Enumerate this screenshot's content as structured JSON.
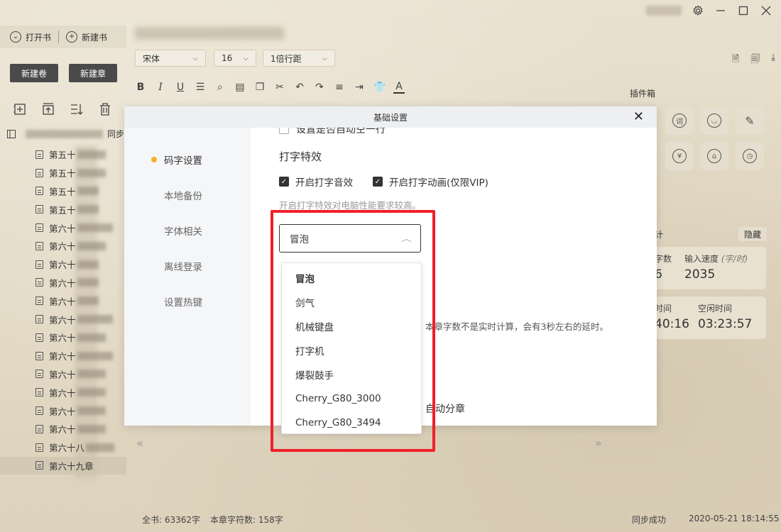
{
  "window": {
    "controls": [
      "settings-icon",
      "minimize-icon",
      "maximize-icon",
      "close-icon"
    ]
  },
  "left": {
    "open_book": "打开书",
    "new_book": "新建书",
    "new_volume": "新建卷",
    "new_chapter": "新建章",
    "sync": "同步",
    "chapters": [
      "第五十",
      "第五十",
      "第五十",
      "第五十",
      "第六十",
      "第六十",
      "第六十",
      "第六十",
      "第六十",
      "第六十",
      "第六十",
      "第六十",
      "第六十",
      "第六十",
      "第六十",
      "第六十",
      "第六十八",
      "第六十九章"
    ]
  },
  "editor": {
    "font": "宋体",
    "size": "16",
    "line_spacing": "1倍行距"
  },
  "plugins": {
    "title": "插件箱"
  },
  "stats": {
    "label": "计",
    "hide": "隐藏",
    "words_label": "字数",
    "words_value": "6",
    "speed_label": "输入速度",
    "speed_unit": "(字/时)",
    "speed_value": "2035",
    "time_label": "时间",
    "time_value": "40:16",
    "idle_label": "空闲时间",
    "idle_value": "03:23:57"
  },
  "status": {
    "total": "全书: 63362字",
    "chapter": "本章字符数: 158字",
    "sync": "同步成功",
    "datetime": "2020-05-21 18:14:55"
  },
  "dialog": {
    "title": "基础设置",
    "sidebar": [
      "码字设置",
      "本地备份",
      "字体相关",
      "离线登录",
      "设置热键"
    ],
    "section_title": "打字特效",
    "sound_label": "开启打字音效",
    "anim_label": "开启打字动画(仅限VIP)",
    "hint": "开启打字特效对电脑性能要求较高。",
    "selected": "冒泡",
    "options": [
      "冒泡",
      "剑气",
      "机械键盘",
      "打字机",
      "爆裂鼓手",
      "Cherry_G80_3000",
      "Cherry_G80_3494"
    ],
    "note": "本章字数不是实时计算，会有3秒左右的延时。",
    "auto_split": "自动分章",
    "cutoff_text": "设置是否自动空一行"
  },
  "colors": {
    "accent_dot": "#f5b12c",
    "highlight": "#f0202a"
  }
}
